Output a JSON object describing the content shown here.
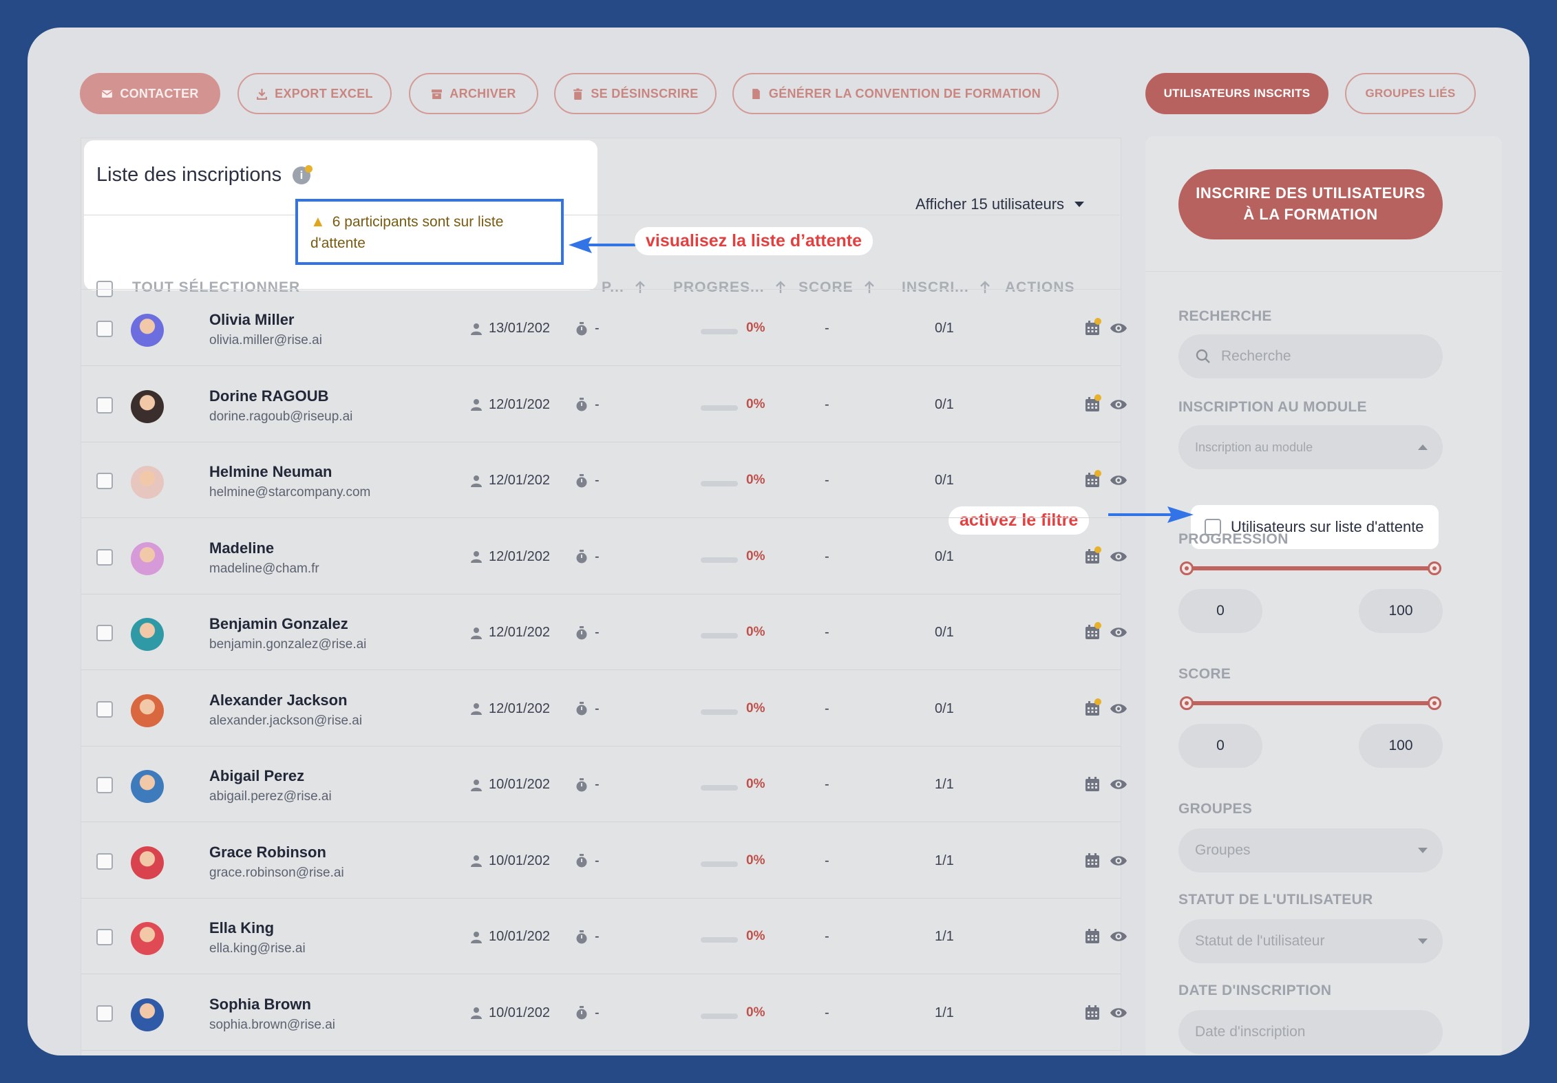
{
  "toolbar": {
    "contact": "CONTACTER",
    "export": "EXPORT EXCEL",
    "archive": "ARCHIVER",
    "unsubscribe": "SE DÉSINSCRIRE",
    "convention": "GÉNÉRER LA CONVENTION DE FORMATION",
    "tab_users": "UTILISATEURS INSCRITS",
    "tab_groups": "GROUPES LIÉS"
  },
  "list": {
    "title": "Liste des inscriptions",
    "info_icon": "i",
    "alert_icon": "warning-icon",
    "alert": "6 participants sont sur liste d'attente",
    "show_select": "Afficher 15 utilisateurs",
    "select_all": "TOUT SÉLECTIONNER",
    "columns": [
      "P...",
      "PROGRES...",
      "SCORE",
      "INSCRI...",
      "ACTIONS"
    ]
  },
  "callouts": {
    "waiting_list": "visualisez la liste d’attente",
    "filter": "activez le filtre"
  },
  "rows": [
    {
      "name": "Olivia Miller",
      "email": "olivia.miller@rise.ai",
      "date": "13/01/202",
      "time": "-",
      "progress": "0%",
      "score": "-",
      "insc": "0/1",
      "waiting": true,
      "avatar_color": "#6c6ee0"
    },
    {
      "name": "Dorine RAGOUB",
      "email": "dorine.ragoub@riseup.ai",
      "date": "12/01/202",
      "time": "-",
      "progress": "0%",
      "score": "-",
      "insc": "0/1",
      "waiting": true,
      "avatar_color": "#3a2f2c"
    },
    {
      "name": "Helmine Neuman",
      "email": "helmine@starcompany.com",
      "date": "12/01/202",
      "time": "-",
      "progress": "0%",
      "score": "-",
      "insc": "0/1",
      "waiting": true,
      "avatar_color": "#e8c6c0"
    },
    {
      "name": "Madeline",
      "email": "madeline@cham.fr",
      "date": "12/01/202",
      "time": "-",
      "progress": "0%",
      "score": "-",
      "insc": "0/1",
      "waiting": true,
      "avatar_color": "#d79ad8"
    },
    {
      "name": "Benjamin Gonzalez",
      "email": "benjamin.gonzalez@rise.ai",
      "date": "12/01/202",
      "time": "-",
      "progress": "0%",
      "score": "-",
      "insc": "0/1",
      "waiting": true,
      "avatar_color": "#2f9aa6"
    },
    {
      "name": "Alexander Jackson",
      "email": "alexander.jackson@rise.ai",
      "date": "12/01/202",
      "time": "-",
      "progress": "0%",
      "score": "-",
      "insc": "0/1",
      "waiting": true,
      "avatar_color": "#d9673f"
    },
    {
      "name": "Abigail Perez",
      "email": "abigail.perez@rise.ai",
      "date": "10/01/202",
      "time": "-",
      "progress": "0%",
      "score": "-",
      "insc": "1/1",
      "waiting": false,
      "avatar_color": "#3e7bbd"
    },
    {
      "name": "Grace Robinson",
      "email": "grace.robinson@rise.ai",
      "date": "10/01/202",
      "time": "-",
      "progress": "0%",
      "score": "-",
      "insc": "1/1",
      "waiting": false,
      "avatar_color": "#d9434e"
    },
    {
      "name": "Ella King",
      "email": "ella.king@rise.ai",
      "date": "10/01/202",
      "time": "-",
      "progress": "0%",
      "score": "-",
      "insc": "1/1",
      "waiting": false,
      "avatar_color": "#e04a55"
    },
    {
      "name": "Sophia Brown",
      "email": "sophia.brown@rise.ai",
      "date": "10/01/202",
      "time": "-",
      "progress": "0%",
      "score": "-",
      "insc": "1/1",
      "waiting": false,
      "avatar_color": "#2e5aa8"
    }
  ],
  "sidebar": {
    "enroll_line1": "INSCRIRE DES UTILISATEURS",
    "enroll_line2": "À LA FORMATION",
    "search_label": "RECHERCHE",
    "search_placeholder": "Recherche",
    "module_label": "INSCRIPTION AU MODULE",
    "module_placeholder": "Inscription au module",
    "waiting_filter": "Utilisateurs sur liste d'attente",
    "progress_label": "PROGRESSION",
    "progress_min": "0",
    "progress_max": "100",
    "score_label": "SCORE",
    "score_min": "0",
    "score_max": "100",
    "groups_label": "GROUPES",
    "groups_placeholder": "Groupes",
    "status_label": "STATUT DE L'UTILISATEUR",
    "status_placeholder": "Statut de l'utilisateur",
    "date_label": "DATE D'INSCRIPTION",
    "date_placeholder": "Date d'inscription"
  },
  "colors": {
    "accent": "#b8625f",
    "highlight": "#3373e8",
    "callout_text": "#e33f3f",
    "waiting_dot": "#e8b12c"
  }
}
